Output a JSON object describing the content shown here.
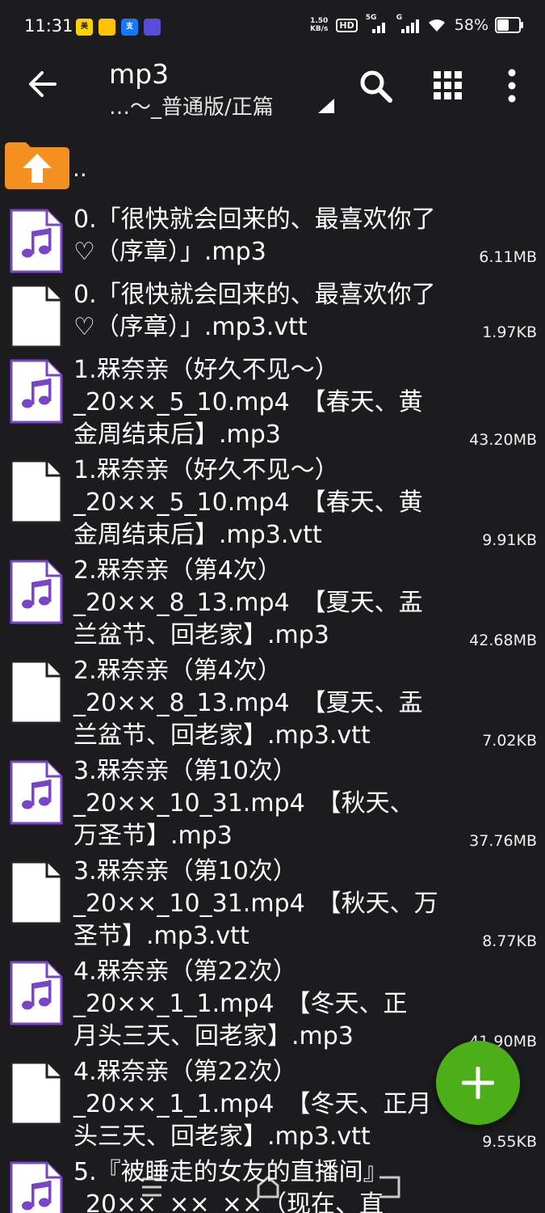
{
  "status": {
    "time": "11:31",
    "net_speed_top": "1.50",
    "net_speed_bottom": "KB/s",
    "hd": "HD",
    "sig1_label": "5G",
    "sig2_label": "G",
    "battery_percent": "58%",
    "battery_level": 0.58
  },
  "toolbar": {
    "title": "mp3",
    "subtitle": "…～_普通版/正篇"
  },
  "parent_row": {
    "label": ".."
  },
  "files": [
    {
      "lines": [
        "0.「很快就会回来的、最喜欢你了",
        "♡（序章）」.mp3"
      ],
      "size": "6.11MB",
      "type": "audio"
    },
    {
      "lines": [
        "0.「很快就会回来的、最喜欢你了",
        "♡（序章）」.mp3.vtt"
      ],
      "size": "1.97KB",
      "type": "doc"
    },
    {
      "lines": [
        "1.槑奈亲（好久不见～）",
        "_20××_5_10.mp4　【春天、黄",
        "金周结束后】.mp3"
      ],
      "size": "43.20MB",
      "type": "audio"
    },
    {
      "lines": [
        "1.槑奈亲（好久不见～）",
        "_20××_5_10.mp4　【春天、黄",
        "金周结束后】.mp3.vtt"
      ],
      "size": "9.91KB",
      "type": "doc"
    },
    {
      "lines": [
        "2.槑奈亲（第4次）",
        "_20××_8_13.mp4　【夏天、盂",
        "兰盆节、回老家】.mp3"
      ],
      "size": "42.68MB",
      "type": "audio"
    },
    {
      "lines": [
        "2.槑奈亲（第4次）",
        "_20××_8_13.mp4　【夏天、盂",
        "兰盆节、回老家】.mp3.vtt"
      ],
      "size": "7.02KB",
      "type": "doc"
    },
    {
      "lines": [
        "3.槑奈亲（第10次）",
        "_20××_10_31.mp4　【秋天、",
        "万圣节】.mp3"
      ],
      "size": "37.76MB",
      "type": "audio"
    },
    {
      "lines": [
        "3.槑奈亲（第10次）",
        "_20××_10_31.mp4　【秋天、万",
        "圣节】.mp3.vtt"
      ],
      "size": "8.77KB",
      "type": "doc"
    },
    {
      "lines": [
        "4.槑奈亲（第22次）",
        "_20××_1_1.mp4　【冬天、正",
        "月头三天、回老家】.mp3"
      ],
      "size": "41.90MB",
      "type": "audio"
    },
    {
      "lines": [
        "4.槑奈亲（第22次）",
        "_20××_1_1.mp4　【冬天、正月",
        "头三天、回老家】.mp3.vtt"
      ],
      "size": "9.55KB",
      "type": "doc"
    },
    {
      "lines": [
        "5.『被睡走的女友的直播间』",
        "_20××_××_××（现在、直"
      ],
      "size": "",
      "type": "audio"
    }
  ],
  "colors": {
    "background": "#1c1c1e",
    "audio_icon_accent": "#7a44c8",
    "folder": "#f39020",
    "fab": "#4caf18"
  }
}
